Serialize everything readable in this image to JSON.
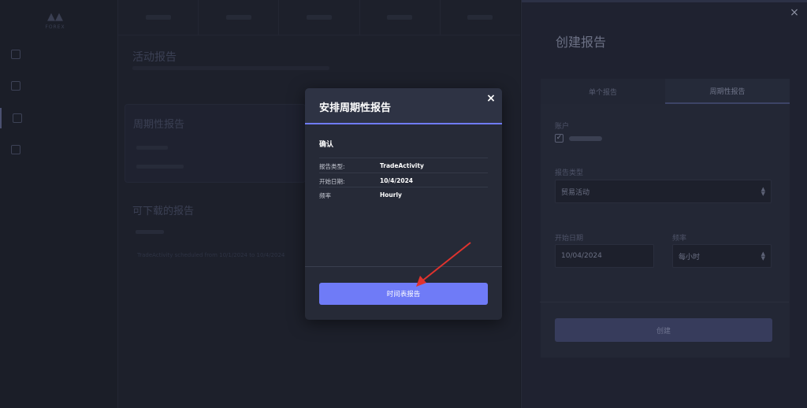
{
  "app": {
    "logo_text": "FOREX",
    "nav": [
      "",
      "",
      "",
      ""
    ],
    "active_nav_label": "",
    "page_title": "活动报告",
    "card1_title": "周期性报告",
    "card2_title": "可下载的报告",
    "download_row": "TradeActivity scheduled from 10/1/2024 to 10/4/2024"
  },
  "drawer": {
    "title": "创建报告",
    "tabs": [
      "单个报告",
      "周期性报告"
    ],
    "account_label": "账户",
    "report_type_label": "报告类型",
    "report_type_value": "贸易活动",
    "start_date_label": "开始日期",
    "start_date_value": "10/04/2024",
    "frequency_label": "频率",
    "frequency_value": "每小时",
    "create_label": "创建",
    "close_glyph": "×"
  },
  "modal": {
    "title": "安排周期性报告",
    "close_glyph": "×",
    "confirm_heading": "确认",
    "rows": [
      {
        "key": "报告类型:",
        "value": "TradeActivity"
      },
      {
        "key": "开始日期:",
        "value": "10/4/2024"
      },
      {
        "key": "频率",
        "value": "Hourly"
      }
    ],
    "submit_label": "时间表报告"
  },
  "colors": {
    "accent": "#6f7bf7",
    "modal_bg": "#262a37",
    "page_bg": "#191c26",
    "annotation": "#e0332e"
  }
}
